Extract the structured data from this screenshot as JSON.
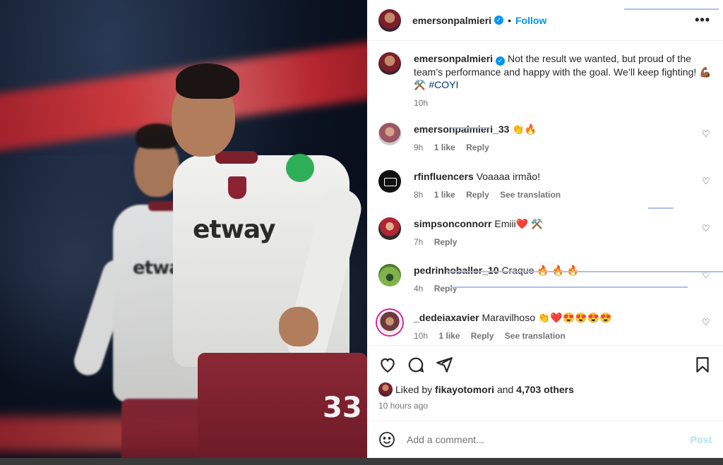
{
  "post_author": {
    "username": "emersonpalmieri",
    "verified_glyph": "✓",
    "follow_label": "Follow",
    "separator": "•",
    "more_label": "•••"
  },
  "caption": {
    "username": "emersonpalmieri",
    "text": "Not the result we wanted, but proud of the team’s performance and happy with the goal. We’ll keep fighting! 💪🏾 ⚒️ ",
    "hashtag": "#COYI",
    "time": "10h"
  },
  "photo": {
    "sponsor_1": "etway",
    "sponsor_2": "etway",
    "shirt_number": "33"
  },
  "comments": [
    {
      "username": "emersonpalmieri_33",
      "text": "👏🔥",
      "time": "9h",
      "likes": "1 like",
      "reply": "Reply",
      "translation": ""
    },
    {
      "username": "rfinfluencers",
      "text": "Voaaaa irmão!",
      "time": "8h",
      "likes": "1 like",
      "reply": "Reply",
      "translation": "See translation"
    },
    {
      "username": "simpsonconnorr",
      "text": "Emiii❤️ ⚒️",
      "time": "7h",
      "likes": "",
      "reply": "Reply",
      "translation": ""
    },
    {
      "username": "pedrinhoballer_10",
      "text": "Craque 🔥 🔥 🔥",
      "time": "4h",
      "likes": "",
      "reply": "Reply",
      "translation": ""
    },
    {
      "username": "_dedeiaxavier",
      "text": "Maravilhoso 👏❤️😍😍😍😍",
      "time": "10h",
      "likes": "1 like",
      "reply": "Reply",
      "translation": "See translation"
    }
  ],
  "likes": {
    "prefix": "Liked by",
    "user": "fikayotomori",
    "middle": "and",
    "count": "4,703 others",
    "ago": "10 hours ago"
  },
  "add_comment": {
    "placeholder": "Add a comment...",
    "post_label": "Post"
  },
  "icons": [
    "heart-icon",
    "comment-icon",
    "share-icon",
    "bookmark-icon",
    "emoji-icon",
    "more-options-icon",
    "verified-icon"
  ],
  "colors": {
    "accent": "#0095f6",
    "post_disabled": "#b2dffc",
    "muted": "#737373"
  }
}
